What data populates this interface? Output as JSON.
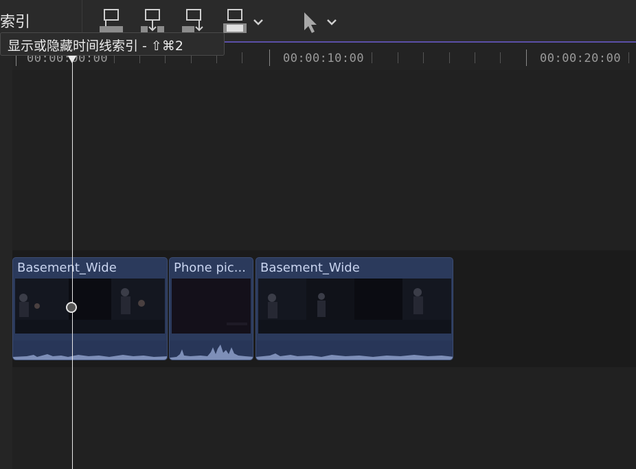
{
  "toolbar": {
    "title": "索引",
    "buttons": [
      {
        "name": "connect-clip-icon"
      },
      {
        "name": "insert-clip-icon"
      },
      {
        "name": "append-clip-icon"
      },
      {
        "name": "overwrite-clip-icon"
      },
      {
        "name": "select-tool-icon"
      }
    ]
  },
  "tooltip": {
    "text": "显示或隐藏时间线索引 - ⇧⌘2"
  },
  "ruler": {
    "timecodes": [
      "00:00:00:00",
      "00:00:10:00",
      "00:00:20:00"
    ]
  },
  "clips": [
    {
      "name": "Basement_Wide"
    },
    {
      "name": "Phone pic..."
    },
    {
      "name": "Basement_Wide"
    }
  ],
  "colors": {
    "clip_bg": "#2b3a5c",
    "clip_label": "#c9d4ef",
    "playhead": "#e9e9e9",
    "timeline_bg": "#1f1f1f"
  }
}
